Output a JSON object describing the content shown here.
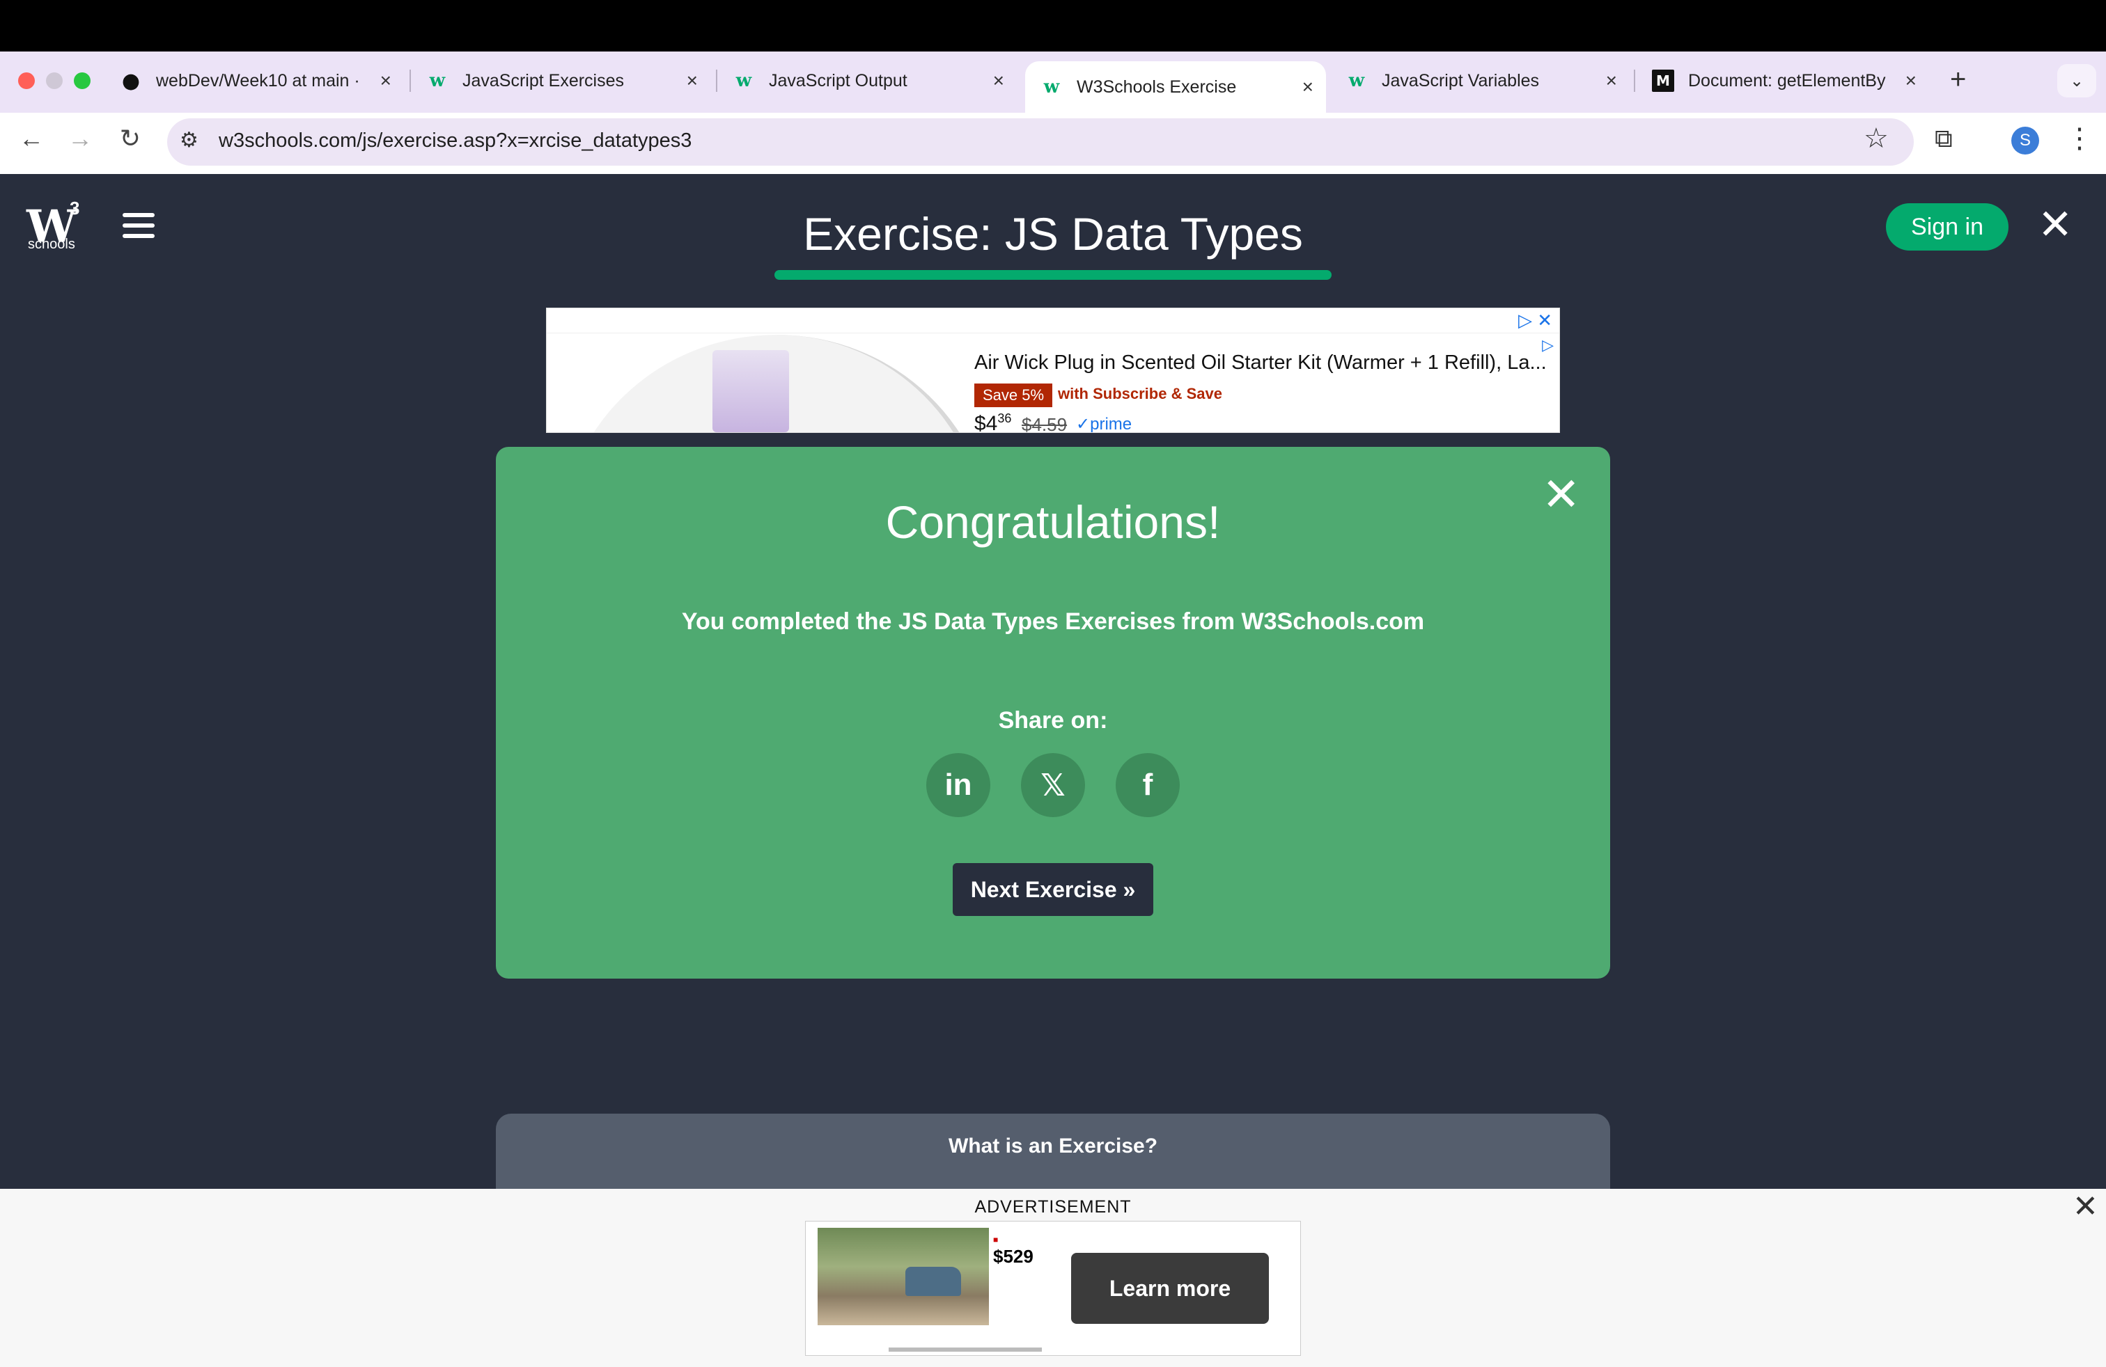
{
  "browser": {
    "tabs": [
      {
        "label": "webDev/Week10 at main ·",
        "icon": "github-icon"
      },
      {
        "label": "JavaScript Exercises",
        "icon": "w3schools-icon"
      },
      {
        "label": "JavaScript Output",
        "icon": "w3schools-icon"
      },
      {
        "label": "W3Schools Exercise",
        "icon": "w3schools-icon",
        "active": true
      },
      {
        "label": "JavaScript Variables",
        "icon": "w3schools-icon"
      },
      {
        "label": "Document: getElementBy",
        "icon": "mdn-icon"
      }
    ],
    "url": "w3schools.com/js/exercise.asp?x=xrcise_datatypes3",
    "profile_initial": "S"
  },
  "header": {
    "logo_mark": "W",
    "logo_sup": "3",
    "logo_text": "schools",
    "title": "Exercise: JS Data Types",
    "sign_in": "Sign in",
    "accent_color": "#04aa6d"
  },
  "ad_top": {
    "title": "Air Wick Plug in Scented Oil Starter Kit (Warmer + 1 Refill), La...",
    "save_badge": "Save 5%",
    "subscribe": "with Subscribe & Save",
    "price_dollars": "$4",
    "price_cents": "36",
    "old_price": "$4.59",
    "prime": "✓prime"
  },
  "modal": {
    "heading": "Congratulations!",
    "message": "You completed the JS Data Types Exercises from W3Schools.com",
    "share_label": "Share on:",
    "share_buttons": [
      {
        "name": "linkedin",
        "glyph": "in"
      },
      {
        "name": "x",
        "glyph": "𝕏"
      },
      {
        "name": "facebook",
        "glyph": "f"
      }
    ],
    "next_button": "Next Exercise »",
    "background_color": "#4faa71"
  },
  "info": {
    "what_is_exercise": "What is an Exercise?"
  },
  "ad_bottom": {
    "label": "ADVERTISEMENT",
    "price": "$529",
    "cta": "Learn more"
  }
}
